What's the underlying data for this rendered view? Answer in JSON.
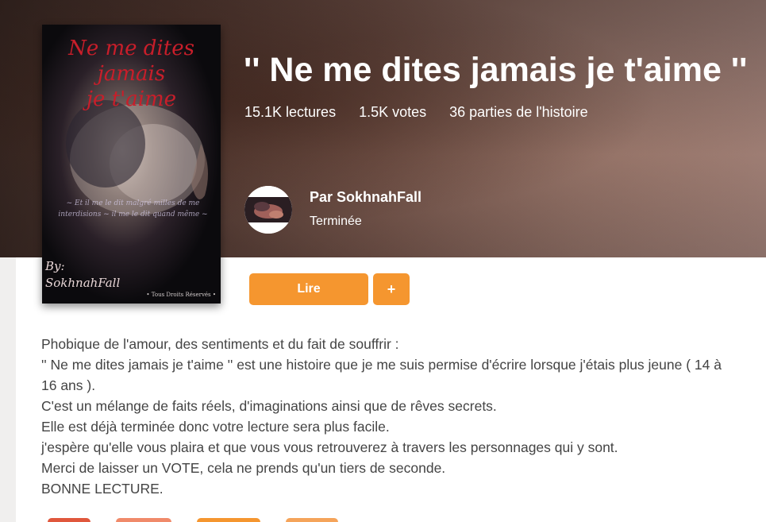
{
  "cover": {
    "title_line1": "Ne me dites jamais",
    "title_line2": "je t'aime",
    "tagline": "~ Et il me le dit malgré milles de me interdisions ~ il me le dit quand même ~",
    "byline_label": "By:",
    "byline_name": "SokhnahFall",
    "rights": "• Tous Droits Réservés •"
  },
  "story": {
    "title": "'' Ne me dites jamais je t'aime ''",
    "stats": {
      "reads": "15.1K lectures",
      "votes": "1.5K votes",
      "parts": "36 parties de l'histoire"
    },
    "author_label": "Par SokhnahFall",
    "status": "Terminée"
  },
  "actions": {
    "read_label": "Lire",
    "add_label": "+"
  },
  "description": [
    "Phobique de l'amour, des sentiments et du fait de souffrir :",
    "'' Ne me dites jamais je t'aime '' est une histoire que je me suis permise d'écrire lorsque j'étais plus jeune ( 14 à 16 ans ).",
    "C'est un mélange de faits réels, d'imaginations ainsi que de rêves secrets.",
    "Elle est déjà terminée donc votre lecture sera plus facile.",
    "j'espère qu'elle vous plaira et que vous vous retrouverez à travers les personnages qui y sont.",
    "Merci de laisser un VOTE, cela ne prends qu'un tiers de seconde.",
    "BONNE LECTURE."
  ],
  "colors": {
    "accent": "#f5962f",
    "cover_title": "#c81e2a",
    "text": "#444444",
    "tag_colors": [
      "#e0573c",
      "#f08a6a",
      "#f5962f",
      "#f5a45a"
    ]
  }
}
